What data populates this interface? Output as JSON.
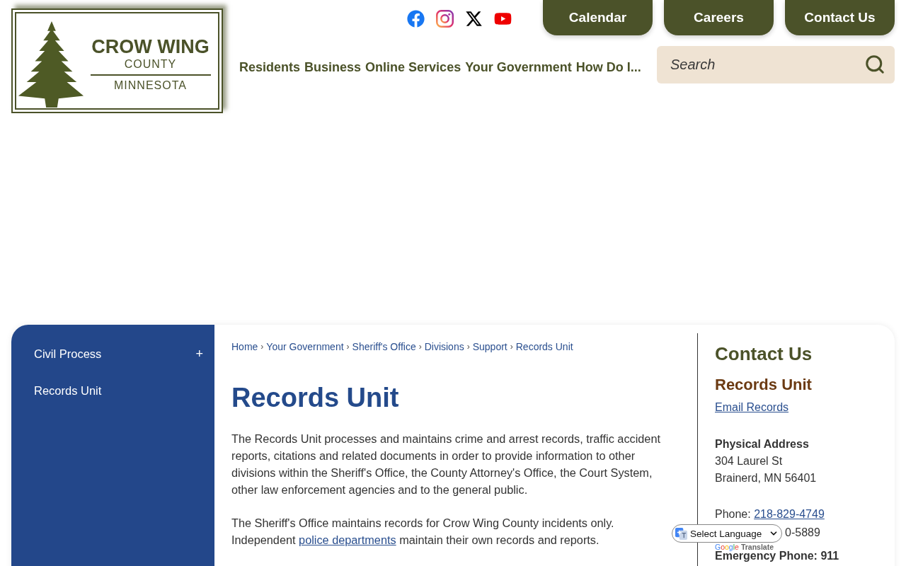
{
  "logo": {
    "line_1": "CROW WING",
    "line_2": "COUNTY",
    "line_3": "MINNESOTA"
  },
  "quick_links": [
    "Calendar",
    "Careers",
    "Contact Us"
  ],
  "search": {
    "placeholder": "Search"
  },
  "nav": [
    "Residents",
    "Business",
    "Online Services",
    "Your Government",
    "How Do I..."
  ],
  "sidebar": {
    "items": [
      {
        "label": "Civil Process",
        "toggle": "+"
      },
      {
        "label": "Records Unit"
      }
    ]
  },
  "breadcrumb": [
    {
      "kind": "link",
      "text": "Home"
    },
    {
      "kind": "separator",
      "text": "›"
    },
    {
      "kind": "link",
      "text": "Your Government"
    },
    {
      "kind": "separator",
      "text": "›"
    },
    {
      "kind": "link",
      "text": "Sheriff's Office"
    },
    {
      "kind": "separator",
      "text": "›"
    },
    {
      "kind": "link",
      "text": "Divisions"
    },
    {
      "kind": "separator",
      "text": "›"
    },
    {
      "kind": "link",
      "text": "Support"
    },
    {
      "kind": "separator",
      "text": "›"
    },
    {
      "kind": "link",
      "text": "Records Unit"
    }
  ],
  "page_title": "Records Unit",
  "paragraphs": [
    {
      "parts": [
        {
          "kind": "text",
          "text": "The Records Unit processes and maintains crime and arrest records, traffic accident reports, citations and related documents in order to provide information to other divisions within the Sheriff's Office, the County Attorney's Office, the Court System, other law enforcement agencies and to the general public."
        }
      ]
    },
    {
      "parts": [
        {
          "kind": "text",
          "text": "The Sheriff's Office maintains records for Crow Wing County incidents only. Independent "
        },
        {
          "kind": "link",
          "text": "police departments"
        },
        {
          "kind": "text",
          "text": " maintain their own records and reports."
        }
      ]
    }
  ],
  "contact": {
    "heading": "Contact Us",
    "department": "Records Unit",
    "email_link": "Email Records",
    "address_label": "Physical Address",
    "address_lines": [
      "304 Laurel St",
      "Brainerd, MN 56401"
    ],
    "phone_label": "Phone: ",
    "phone": "218-829-4749",
    "fax_visible": "0-5889",
    "emergency": "Emergency Phone: 911"
  },
  "translate": {
    "select": "Select Language",
    "brand": "Google",
    "label": "Translate"
  }
}
